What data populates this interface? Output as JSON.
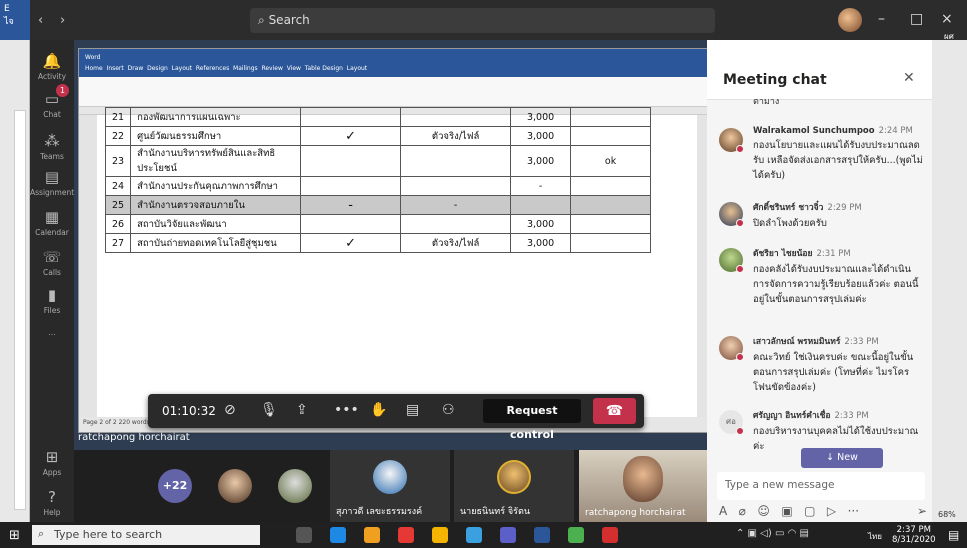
{
  "window": {
    "search_placeholder": "Search",
    "minimize": "–",
    "maximize": "□",
    "close": "×",
    "back": "‹",
    "forward": "›"
  },
  "word_sidebar": {
    "app_letter": "E",
    "user_short": "ไจ",
    "zoom": "68%",
    "right_name": "ผศ"
  },
  "rail": [
    {
      "label": "Activity",
      "icon": "bell-icon"
    },
    {
      "label": "Chat",
      "icon": "chat-icon"
    },
    {
      "label": "Teams",
      "icon": "teams-icon"
    },
    {
      "label": "Assignments",
      "icon": "assignments-icon"
    },
    {
      "label": "Calendar",
      "icon": "calendar-icon"
    },
    {
      "label": "Calls",
      "icon": "calls-icon"
    },
    {
      "label": "Files",
      "icon": "files-icon"
    },
    {
      "label": "...",
      "icon": "more-icon"
    },
    {
      "label": "Apps",
      "icon": "apps-icon"
    },
    {
      "label": "Help",
      "icon": "help-icon"
    }
  ],
  "chat_badge": "1",
  "shared_word": {
    "title": "Word",
    "tabs": [
      "Home",
      "Insert",
      "Draw",
      "Design",
      "Layout",
      "References",
      "Mailings",
      "Review",
      "View",
      "Table Design",
      "Layout"
    ],
    "status": "Page 2 of 2   220 words"
  },
  "table": {
    "rows": [
      {
        "no": "21",
        "name": "กองพัฒนาการแผนเฉพาะ",
        "mark": "",
        "status": "",
        "amount": "3,000",
        "note": "",
        "shaded": false
      },
      {
        "no": "22",
        "name": "ศูนย์วัฒนธรรมศึกษา",
        "mark": "✓",
        "status": "ตัวจริง/ไฟล์",
        "amount": "3,000",
        "note": "",
        "shaded": false
      },
      {
        "no": "23",
        "name": "สำนักงานบริหารทรัพย์สินและสิทธิประโยชน์",
        "mark": "",
        "status": "",
        "amount": "3,000",
        "note": "ok",
        "shaded": false
      },
      {
        "no": "24",
        "name": "สำนักงานประกันคุณภาพการศึกษา",
        "mark": "",
        "status": "",
        "amount": "-",
        "note": "",
        "shaded": false
      },
      {
        "no": "25",
        "name": "สำนักงานตรวจสอบภายใน",
        "mark": "-",
        "status": "-",
        "amount": "",
        "note": "",
        "shaded": true
      },
      {
        "no": "26",
        "name": "สถาบันวิจัยและพัฒนา",
        "mark": "",
        "status": "",
        "amount": "3,000",
        "note": "",
        "shaded": false
      },
      {
        "no": "27",
        "name": "สถาบันถ่ายทอดเทคโนโลยีสู่ชุมชน",
        "mark": "✓",
        "status": "ตัวจริง/ไฟล์",
        "amount": "3,000",
        "note": "",
        "shaded": false
      }
    ]
  },
  "presenter": "ratchapong horchairat",
  "controls": {
    "timer": "01:10:32",
    "request": "Request control"
  },
  "gallery": {
    "overflow": "+22",
    "names": [
      "สุภาวดี เลขะธรรมรงค์",
      "นายธนินทร์ จิรัตน",
      "ratchapong horchairat"
    ]
  },
  "chat": {
    "title": "Meeting chat",
    "truncated": "ตามาง",
    "messages": [
      {
        "name": "Walrakamol Sunchumpoo",
        "time": "2:24 PM",
        "text": "กองนโยบายและแผนได้รับงบประมาณลดรับ เหลือจัดส่งเอกสารสรุปให้ครับ...(พูดไม่ได้ครับ)"
      },
      {
        "name": "ศักดิ์ชรินทร์ ชาวจิ๋ว",
        "time": "2:29 PM",
        "text": "ปิดลำโพงด้วยครับ"
      },
      {
        "name": "ดัชริยา ไชยน้อย",
        "time": "2:31 PM",
        "text": "กองคลังได้รับงบประมาณและได้ดำเนินการจัดการความรู้เรียบร้อยแล้วค่ะ ตอนนี้อยู่ในขั้นตอนการสรุปเล่มค่ะ"
      },
      {
        "name": "เสาวลักษณ์ พรหมมินทร์",
        "time": "2:33 PM",
        "text": "คณะวิทย์ ใช่เงินครบค่ะ ขณะนี้อยู่ในขั้นตอนการสรุปเล่มค่ะ (โทษที่ค่ะ ไมรโครโฟนขัดข้องค่ะ)"
      },
      {
        "name": "ศรัญญา อินทร์คำเชื่อ",
        "time": "2:33 PM",
        "initials": "ศอ",
        "text": "กองบริหารงานบุคคลไม่ได้ใช้งบประมาณค่ะ"
      }
    ],
    "new_messages": "↓  New messages",
    "compose_placeholder": "Type a new message"
  },
  "taskbar": {
    "search": "Type here to search",
    "time": "2:37 PM",
    "date": "8/31/2020",
    "lang": "ไทย"
  }
}
